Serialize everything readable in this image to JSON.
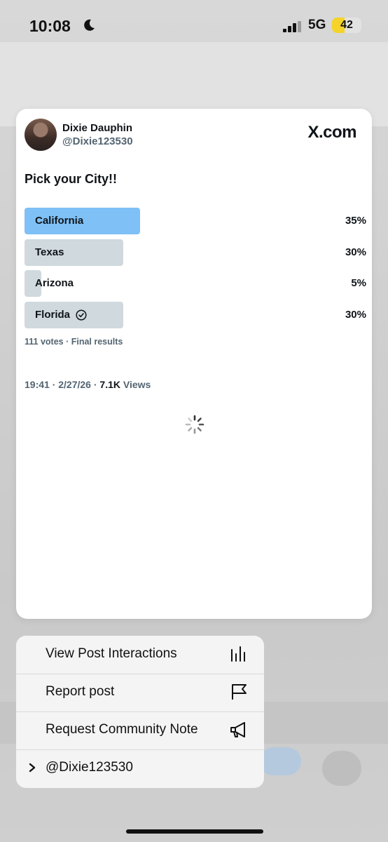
{
  "status": {
    "time": "10:08",
    "network": "5G",
    "battery": "42",
    "battery_level": 0.42
  },
  "post": {
    "author_name": "Dixie Dauphin",
    "author_handle": "@Dixie123530",
    "brand": "X.com",
    "question": "Pick your City!!",
    "options": [
      {
        "label": "California",
        "percent_label": "35%",
        "percent": 35,
        "leading": true
      },
      {
        "label": "Texas",
        "percent_label": "30%",
        "percent": 30,
        "leading": false
      },
      {
        "label": "Arizona",
        "percent_label": "5%",
        "percent": 5,
        "leading": false
      },
      {
        "label": "Florida",
        "percent_label": "30%",
        "percent": 30,
        "leading": false,
        "voted": true
      }
    ],
    "votes_summary": "111 votes · Final results",
    "timestamp": "19:41 · 2/27/26 · ",
    "views_count": "7.1K",
    "views_label": " Views"
  },
  "menu": {
    "items": [
      {
        "label": "View Post Interactions",
        "icon": "bar-chart-icon"
      },
      {
        "label": "Report post",
        "icon": "flag-icon"
      },
      {
        "label": "Request Community Note",
        "icon": "megaphone-icon"
      },
      {
        "label": "@Dixie123530",
        "icon": "chevron-right-icon"
      }
    ]
  }
}
